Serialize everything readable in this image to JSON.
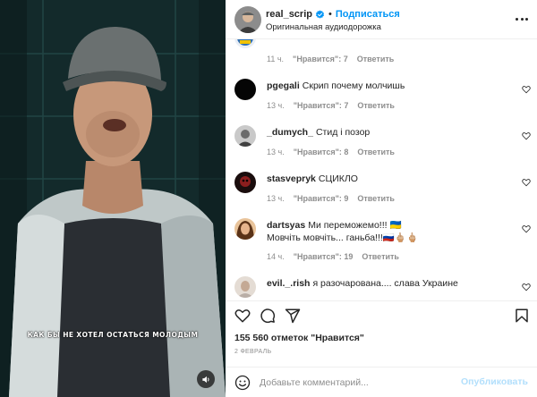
{
  "video": {
    "subtitle": "КАК БЫ НЕ ХОТЕЛ ОСТАТЬСЯ МОЛОДЫМ",
    "mute_icon": "speaker-icon"
  },
  "header": {
    "username": "real_scrip",
    "separator": "•",
    "follow_label": "Подписаться",
    "audio_label": "Оригинальная аудиодорожка"
  },
  "comments": [
    {
      "username": "",
      "text": "",
      "time": "11 ч.",
      "likes": "\"Нравится\": 7",
      "reply": "Ответить",
      "avatar_color": "#2f6fb5"
    },
    {
      "username": "pgegali",
      "text": "Скрип почему молчишь",
      "time": "13 ч.",
      "likes": "\"Нравится\": 7",
      "reply": "Ответить",
      "avatar_color": "#0a0a0a"
    },
    {
      "username": "_dumych_",
      "text": "Стид і позор",
      "time": "13 ч.",
      "likes": "\"Нравится\": 8",
      "reply": "Ответить",
      "avatar_color": "#6b6b6b"
    },
    {
      "username": "stasvepryk",
      "text": "СЦИКЛО",
      "time": "13 ч.",
      "likes": "\"Нравится\": 9",
      "reply": "Ответить",
      "avatar_color": "#3a1a1a"
    },
    {
      "username": "dartsyas",
      "text": "Ми переможемо!!! 🇺🇦",
      "text2": "Мовчіть мовчіть... ганьба!!!🇷🇺🖕🏼🖕🏼",
      "time": "14 ч.",
      "likes": "\"Нравится\": 19",
      "reply": "Ответить",
      "avatar_color": "#c4905a"
    },
    {
      "username": "evil._.rish",
      "text": "я разочарована.... слава Украине",
      "time": "",
      "likes": "",
      "reply": "",
      "avatar_color": "#d9cbbf"
    }
  ],
  "actions": {
    "like_icon": "heart-icon",
    "comment_icon": "comment-icon",
    "share_icon": "send-icon",
    "save_icon": "bookmark-icon"
  },
  "likes_text": "155 560 отметок \"Нравится\"",
  "date_text": "2 ФЕВРАЛЬ",
  "add_comment": {
    "placeholder": "Добавьте комментарий...",
    "publish_label": "Опубликовать"
  },
  "colors": {
    "accent": "#0095f6",
    "publish_disabled": "#b2dffc",
    "muted": "#8e8e8e"
  }
}
